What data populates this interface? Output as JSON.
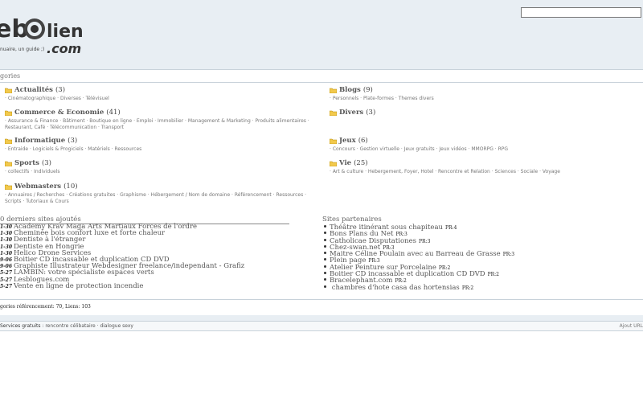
{
  "header": {
    "logo_text_left": "eb",
    "logo_text_right": "liens",
    "logo_text_dotcom": ".com",
    "tagline": "nuaire, un guide ;)",
    "search_placeholder": ""
  },
  "categories_bar": {
    "title": "gories"
  },
  "categories": [
    {
      "name": "Actualités",
      "count": "(3)",
      "subs": "· Cinématographique · Diverses · Télévisuel"
    },
    {
      "name": "Blogs",
      "count": "(9)",
      "subs": "· Personnels · Plate-formes · Themes divers"
    },
    {
      "name": "Commerce & Economie",
      "count": "(41)",
      "subs": "· Assurance & Finance · Bâtiment · Boutique en ligne · Emploi · Immobilier · Management & Marketing · Produits alimentaires · Restaurant, Café · Télécommunication · Transport"
    },
    {
      "name": "Divers",
      "count": "(3)",
      "subs": ""
    },
    {
      "name": "Informatique",
      "count": "(3)",
      "subs": "· Entraide · Logiciels & Progiciels · Matériels · Ressources"
    },
    {
      "name": "Jeux",
      "count": "(6)",
      "subs": "· Concours · Gestion virtuelle · Jeux gratuits · Jeux vidéos · MMORPG · RPG"
    },
    {
      "name": "Sports",
      "count": "(3)",
      "subs": "· collectifs · Individuels"
    },
    {
      "name": "Vie",
      "count": "(25)",
      "subs": "· Art & culture · Hebergement, Foyer, Hotel · Rencontre et Relation · Sciences · Sociale · Voyage"
    },
    {
      "name": "Webmasters",
      "count": "(10)",
      "subs": "· Annuaires / Recherches · Créations gratuites · Graphisme · Hébergement / Nom de domaine · Référencement · Ressources · Scripts · Tutoriaux & Cours"
    }
  ],
  "recent": {
    "title": "0 derniers sites ajoutés",
    "items": [
      {
        "date": "1-30",
        "label": "Academy Krav Maga Arts Martiaux Forces de l'ordre"
      },
      {
        "date": "1-30",
        "label": "Cheminée bois confort luxe et forte chaleur"
      },
      {
        "date": "1-30",
        "label": "Dentiste à l'étranger"
      },
      {
        "date": "1-30",
        "label": "Dentiste en Hongrie"
      },
      {
        "date": "1-30",
        "label": "Helico Drone Services"
      },
      {
        "date": "9-06",
        "label": "Boitier CD incassable et duplication CD DVD"
      },
      {
        "date": "9-06",
        "label": "Graphiste Illustrateur Webdesigner freelance/independant - Grafiz"
      },
      {
        "date": "5-27",
        "label": "LAMBIN: votre spécialiste espaces verts"
      },
      {
        "date": "5-27",
        "label": "Lesblogues.com"
      },
      {
        "date": "5-27",
        "label": "Vente en ligne de protection incendie"
      }
    ]
  },
  "partners": {
    "title": "Sites partenaires",
    "items": [
      {
        "label": "Théâtre itinérant sous chapiteau",
        "pr": "PR:4"
      },
      {
        "label": "Bons Plans du Net",
        "pr": "PR:3"
      },
      {
        "label": "Catholicae Disputationes",
        "pr": "PR:3"
      },
      {
        "label": "Chez-swan.net",
        "pr": "PR:3"
      },
      {
        "label": "Maitre Céline Poulain avec au Barreau de Grasse",
        "pr": "PR:3"
      },
      {
        "label": "Plein page",
        "pr": "PR:3"
      },
      {
        "label": "Atelier Peinture sur Porcelaine",
        "pr": "PR:2"
      },
      {
        "label": "Boitier CD incassable et duplication CD DVD",
        "pr": "PR:2"
      },
      {
        "label": "Bracelephant.com",
        "pr": "PR:2"
      },
      {
        "label": " chambres d'hote casa das hortensias",
        "pr": "PR:2"
      }
    ]
  },
  "stats": {
    "text": "gories référencement: 70, Liens: 103"
  },
  "footer": {
    "services_label": "Services gratuits",
    "services_links": ": rencontre célibataire · dialogue sexy",
    "right_link": "Ajout URL"
  },
  "colors": {
    "header_bg": "#e8eef3",
    "folder": "#f2c94c",
    "border": "#c8d2da"
  }
}
